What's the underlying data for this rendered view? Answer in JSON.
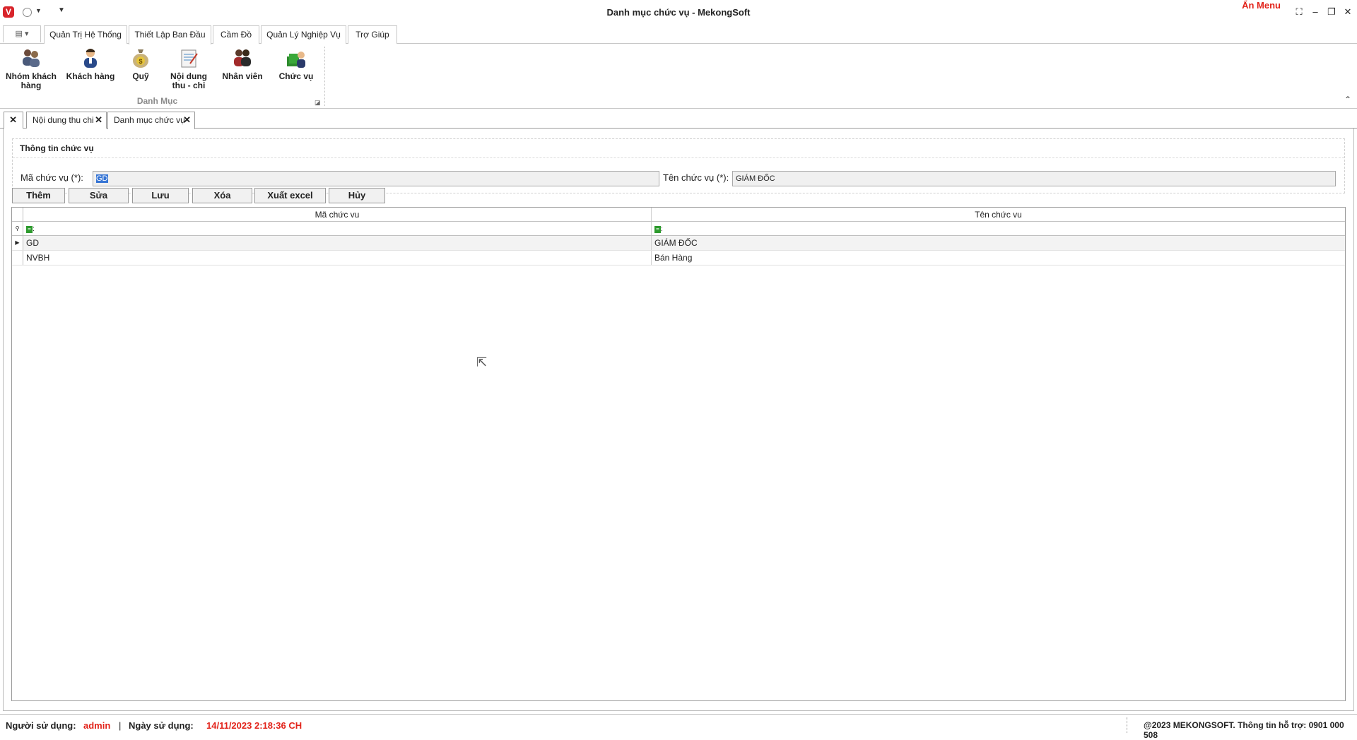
{
  "window": {
    "title": "Danh mục chức vụ - MekongSoft",
    "hide_menu": "Ẩn Menu",
    "logo_letter": "V"
  },
  "ribbon_tabs": [
    {
      "label": "Quản Trị Hệ Thống"
    },
    {
      "label": "Thiết Lập Ban Đầu"
    },
    {
      "label": "Cầm Đồ"
    },
    {
      "label": "Quản Lý Nghiệp Vụ"
    },
    {
      "label": "Trợ Giúp"
    }
  ],
  "ribbon": {
    "group_label": "Danh Mục",
    "buttons": [
      {
        "label": "Nhóm khách hàng",
        "icon": "customer-group-icon"
      },
      {
        "label": "Khách hàng",
        "icon": "customer-icon"
      },
      {
        "label": "Quỹ",
        "icon": "money-bag-icon"
      },
      {
        "label": "Nội dung thu - chi",
        "icon": "notepad-icon"
      },
      {
        "label": "Nhân viên",
        "icon": "employees-icon"
      },
      {
        "label": "Chức vụ",
        "icon": "position-icon"
      }
    ]
  },
  "doc_tabs": [
    {
      "label": "Nội dung thu chi"
    },
    {
      "label": "Danh mục chức vụ"
    }
  ],
  "form": {
    "section_title": "Thông tin chức vụ",
    "code_label": "Mã chức vụ (*):",
    "code_value": "GD",
    "name_label": "Tên chức vụ (*):",
    "name_value": "GIÁM ĐỐC"
  },
  "actions": {
    "add": "Thêm",
    "edit": "Sửa",
    "save": "Lưu",
    "delete": "Xóa",
    "export": "Xuất excel",
    "cancel": "Hủy"
  },
  "grid": {
    "headers": [
      "Mã chức vu",
      "Tên chức vu"
    ],
    "filter_marker": ":",
    "rows": [
      {
        "code": "GD",
        "name": "GIÁM ĐỐC"
      },
      {
        "code": "NVBH",
        "name": "Bán Hàng"
      }
    ]
  },
  "status": {
    "user_label": "Người sử dụng:",
    "user_value": "admin",
    "divider": "|",
    "date_label": "Ngày sử dụng:",
    "date_value": "14/11/2023 2:18:36 CH",
    "copyright": "@2023 MEKONGSOFT. Thông tin hỗ trợ: 0901 000 508"
  },
  "colors": {
    "accent_red": "#e2231a",
    "selection_blue": "#3574d4",
    "filter_green": "#2d9a2d"
  }
}
